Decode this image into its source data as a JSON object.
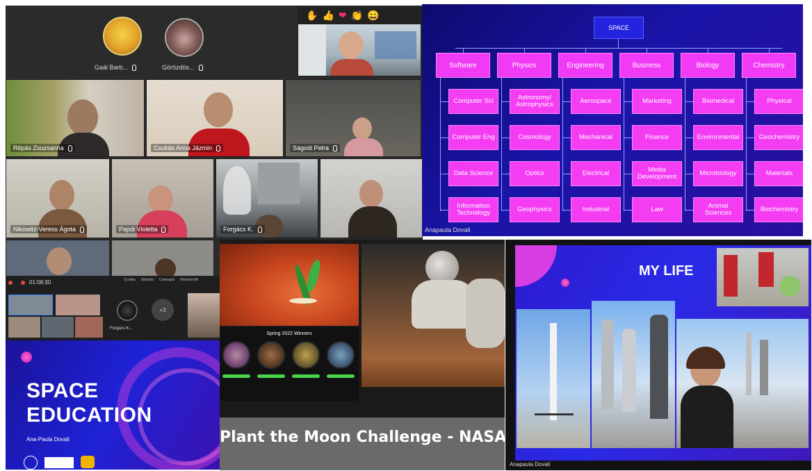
{
  "meeting": {
    "top_participants": [
      {
        "name": "Gaál Barb..."
      },
      {
        "name": "Görözdös..."
      }
    ],
    "reactions": [
      "✋",
      "👍",
      "❤",
      "👏",
      "😄"
    ],
    "tiles": [
      {
        "name": "Répás Zsuzsanna"
      },
      {
        "name": "Csukás Anna Jázmin"
      },
      {
        "name": "Ságodi Petra"
      },
      {
        "name": "Nikowitz-Veress Ágota"
      },
      {
        "name": "Papdi Violetta"
      },
      {
        "name": "Forgács K."
      }
    ],
    "mini_window": {
      "timer": "01:08:30",
      "toolbar": [
        "Új adás",
        "Előadás",
        "Csevegés",
        "Résztvevők"
      ],
      "participant": "Forgács K...",
      "overflow": "+3"
    }
  },
  "mindmap": {
    "root": "SPACE",
    "presenter": "Anapaula Dovali",
    "categories": [
      {
        "label": "Software",
        "items": [
          "Computer Sci",
          "Computer Eng",
          "Data Science",
          "Information Technology"
        ]
      },
      {
        "label": "Physics",
        "items": [
          "Astronomy/ Astrophysics",
          "Cosmology",
          "Optics",
          "Geophysics"
        ]
      },
      {
        "label": "Engineering",
        "items": [
          "Aerospace",
          "Mechanical",
          "Electrical",
          "Industrial"
        ]
      },
      {
        "label": "Business",
        "items": [
          "Marketing",
          "Finance",
          "Media Development",
          "Law"
        ]
      },
      {
        "label": "Biology",
        "items": [
          "Biomedical",
          "Environmental",
          "Microbiology",
          "Animal Sciences"
        ]
      },
      {
        "label": "Chemistry",
        "items": [
          "Physical",
          "Geochemistry",
          "Materials",
          "Biochemistry"
        ]
      }
    ]
  },
  "nasa": {
    "winners_title": "Spring 2022 Winners",
    "caption": "Plant the Moon Challenge - NASA"
  },
  "education_slide": {
    "title_line1": "SPACE",
    "title_line2": "EDUCATION",
    "author": "Ana-Paula Dovali"
  },
  "mylife": {
    "title": "MY LIFE",
    "presenter": "Anapaula Dovali"
  }
}
